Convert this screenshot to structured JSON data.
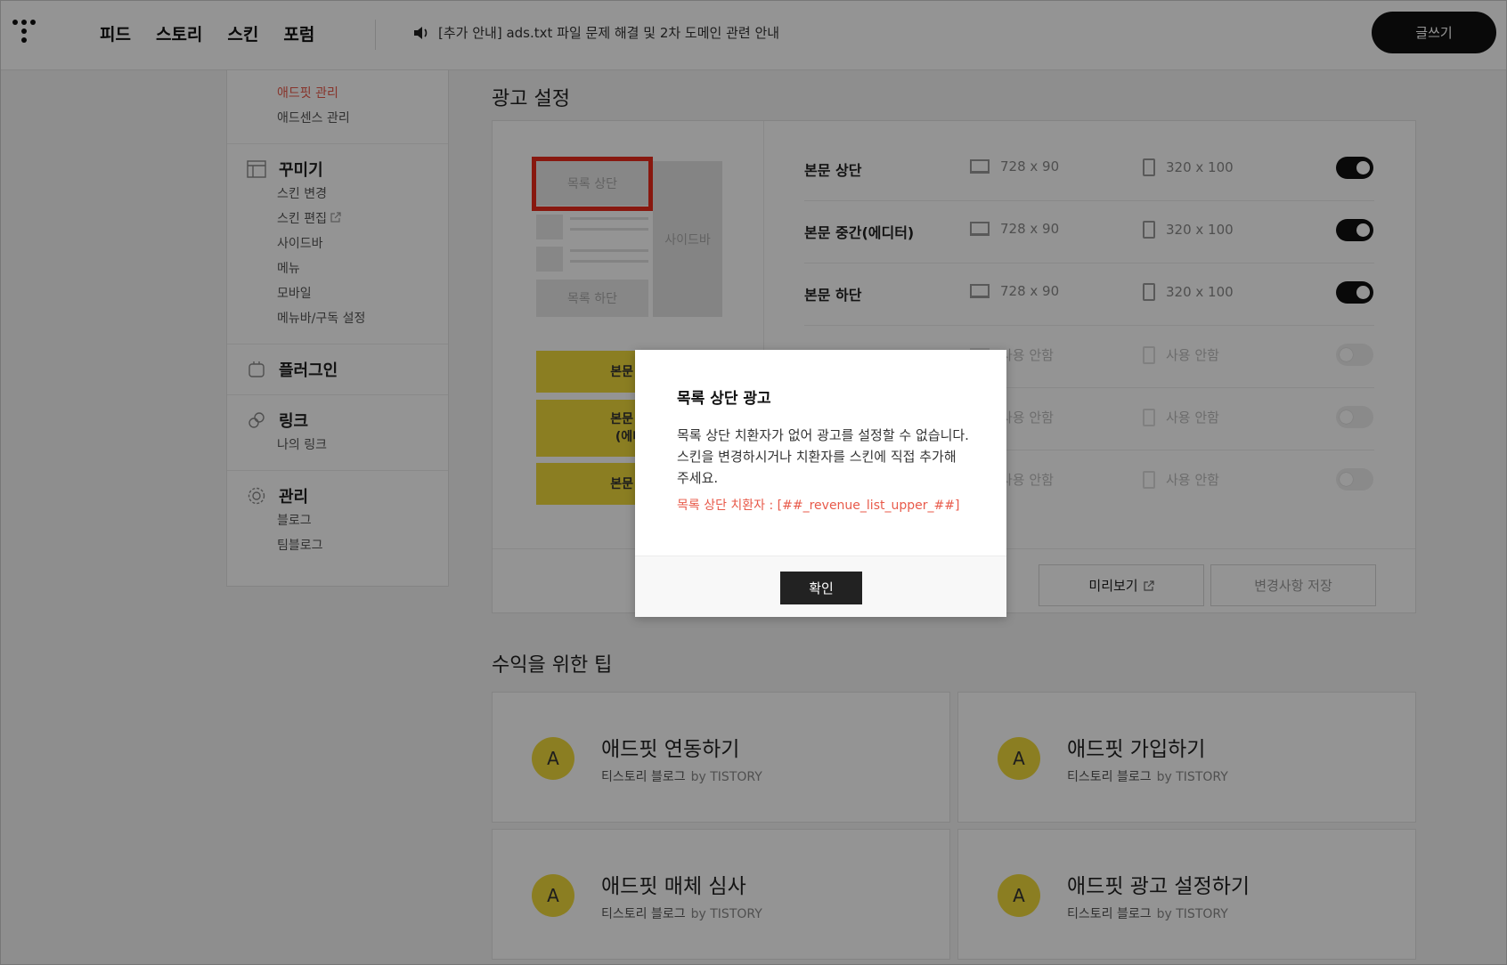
{
  "header": {
    "nav": [
      "피드",
      "스토리",
      "스킨",
      "포럼"
    ],
    "notice": "[추가 안내] ads.txt 파일 문제 해결 및 2차 도메인 관련 안내",
    "write_button": "글쓰기"
  },
  "sidebar": {
    "revenue_items": [
      "애드핏 관리",
      "애드센스 관리"
    ],
    "groups": [
      {
        "title": "꾸미기",
        "icon": "layout-icon",
        "items": [
          "스킨 변경",
          "스킨 편집",
          "사이드바",
          "메뉴",
          "모바일",
          "메뉴바/구독 설정"
        ]
      },
      {
        "title": "플러그인",
        "icon": "plugin-icon",
        "items": []
      },
      {
        "title": "링크",
        "icon": "link-icon",
        "items": [
          "나의 링크"
        ]
      },
      {
        "title": "관리",
        "icon": "gear-icon",
        "items": [
          "블로그",
          "팀블로그"
        ]
      }
    ]
  },
  "ad_settings": {
    "title": "광고 설정",
    "preview": {
      "list_top": "목록 상단",
      "list_bottom": "목록 하단",
      "sidebar": "사이드바",
      "yellow_1": "본문 상",
      "yellow_2_line1": "본문 중",
      "yellow_2_line2": "(에디",
      "yellow_3": "본문 하"
    },
    "rows": [
      {
        "name": "본문 상단",
        "pc": "728 x 90",
        "mobile": "320 x 100",
        "on": true
      },
      {
        "name": "본문 중간(에디터)",
        "pc": "728 x 90",
        "mobile": "320 x 100",
        "on": true
      },
      {
        "name": "본문 하단",
        "pc": "728 x 90",
        "mobile": "320 x 100",
        "on": true
      },
      {
        "name": "",
        "pc": "사용 안함",
        "mobile": "사용 안함",
        "on": false
      },
      {
        "name": "",
        "pc": "사용 안함",
        "mobile": "사용 안함",
        "on": false
      },
      {
        "name": "",
        "pc": "사용 안함",
        "mobile": "사용 안함",
        "on": false
      }
    ],
    "preview_button": "미리보기",
    "save_button": "변경사항 저장"
  },
  "tips": {
    "title": "수익을 위한 팁",
    "cards": [
      {
        "badge": "A",
        "name": "애드핏 연동하기",
        "blog": "티스토리 블로그",
        "by": "by TISTORY"
      },
      {
        "badge": "A",
        "name": "애드핏 가입하기",
        "blog": "티스토리 블로그",
        "by": "by TISTORY"
      },
      {
        "badge": "A",
        "name": "애드핏 매체 심사",
        "blog": "티스토리 블로그",
        "by": "by TISTORY"
      },
      {
        "badge": "A",
        "name": "애드핏 광고 설정하기",
        "blog": "티스토리 블로그",
        "by": "by TISTORY"
      }
    ]
  },
  "modal": {
    "title": "목록 상단 광고",
    "body": "목록 상단 치환자가 없어 광고를 설정할 수 없습니다. 스킨을 변경하시거나 치환자를 스킨에 직접 추가해 주세요.",
    "code": "목록 상단 치환자 : [##_revenue_list_upper_##]",
    "ok_button": "확인"
  },
  "colors": {
    "accent_red": "#e85a4a",
    "highlight_red": "#ea2a1a",
    "yellow": "#f0d93c"
  }
}
